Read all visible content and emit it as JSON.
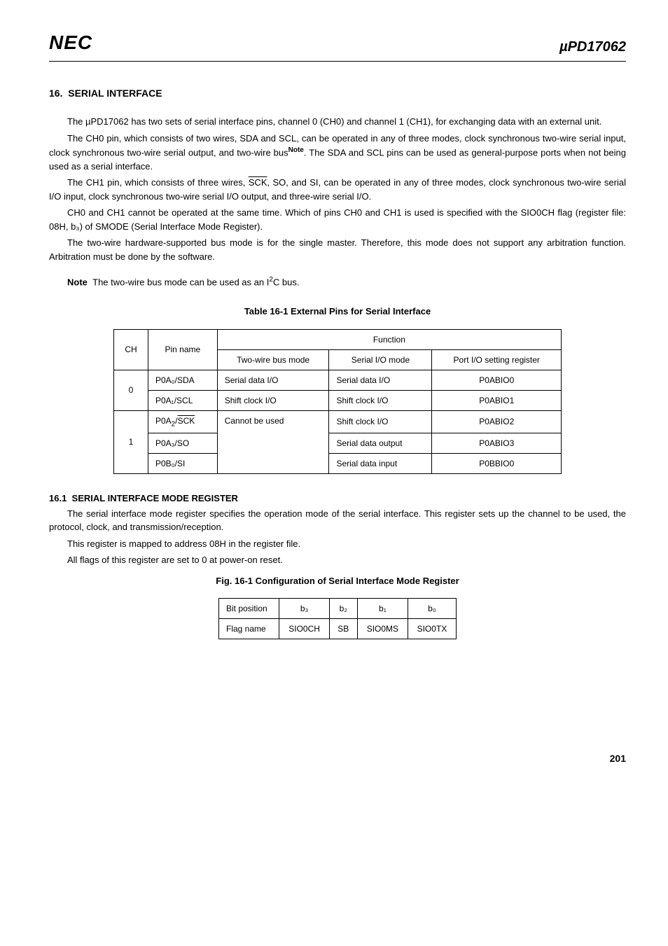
{
  "header": {
    "logo": "NEC",
    "partPrefix": "µ",
    "partNumber": "PD17062"
  },
  "section": {
    "number": "16.",
    "title": "SERIAL INTERFACE"
  },
  "para1a": "The µPD17062 has two sets of serial interface pins, channel 0 (CH0) and channel 1 (CH1), for exchanging data with an external unit.",
  "para2a": "The CH0 pin, which consists of two wires, SDA and SCL, can be operated in any of three modes, clock synchronous two-wire serial input, clock synchronous two-wire serial output, and two-wire bus",
  "para2note": "Note",
  "para2b": ".  The SDA and SCL pins can be used as general-purpose ports when not being used as a serial interface.",
  "para3a": "The CH1 pin, which consists of three wires, ",
  "para3sck": "SCK",
  "para3b": ", SO, and SI, can be operated in any of three modes, clock synchronous two-wire serial I/O input, clock synchronous two-wire serial I/O output, and three-wire serial I/O.",
  "para4": "CH0 and CH1 cannot be operated at the same time.  Which of pins CH0 and CH1 is used is specified with the SIO0CH flag (register file:  08H, b₃) of SMODE (Serial Interface Mode Register).",
  "para5": "The two-wire hardware-supported bus mode is for the single master.  Therefore, this mode does not support any arbitration function.  Arbitration must be done by the software.",
  "note": {
    "label": "Note",
    "textA": "The two-wire bus mode can be used as an I",
    "sup2": "2",
    "textB": "C bus."
  },
  "table1": {
    "title": "Table 16-1   External Pins for Serial Interface",
    "headCH": "CH",
    "headPin": "Pin name",
    "headFunction": "Function",
    "headTwoWire": "Two-wire bus mode",
    "headSerialIO": "Serial I/O mode",
    "headPortReg": "Port I/O setting register",
    "rows": [
      {
        "ch": "0",
        "pin": "P0A₀/SDA",
        "c1": "Serial data I/O",
        "c2": "Serial data I/O",
        "c3": "P0ABIO0"
      },
      {
        "ch": "",
        "pin": "P0A₁/SCL",
        "c1": "Shift clock I/O",
        "c2": "Shift clock I/O",
        "c3": "P0ABIO1"
      },
      {
        "ch": "1",
        "pin": "P0A₂/SCK",
        "pinOverline": "SCK",
        "cannot": "Cannot be used",
        "c2": "Shift clock I/O",
        "c3": "P0ABIO2"
      },
      {
        "ch": "",
        "pin": "P0A₃/SO",
        "c2": "Serial data output",
        "c3": "P0ABIO3"
      },
      {
        "ch": "",
        "pin": "P0B₀/SI",
        "c2": "Serial data input",
        "c3": "P0BBIO0"
      }
    ]
  },
  "subsection": {
    "number": "16.1",
    "title": "SERIAL INTERFACE MODE REGISTER"
  },
  "spara1": "The serial interface mode register specifies the operation mode of the serial interface.  This register sets up the channel to be used, the protocol, clock, and transmission/reception.",
  "spara2": "This register is mapped to address 08H in the register file.",
  "spara3": "All flags of this register are set to 0 at power-on reset.",
  "fig": {
    "title": "Fig. 16-1   Configuration of Serial Interface Mode Register",
    "hBit": "Bit position",
    "b3": "b₃",
    "b2": "b₂",
    "b1": "b₁",
    "b0": "b₀",
    "hFlag": "Flag name",
    "f3": "SIO0CH",
    "f2": "SB",
    "f1": "SIO0MS",
    "f0": "SIO0TX"
  },
  "pageno": "201"
}
